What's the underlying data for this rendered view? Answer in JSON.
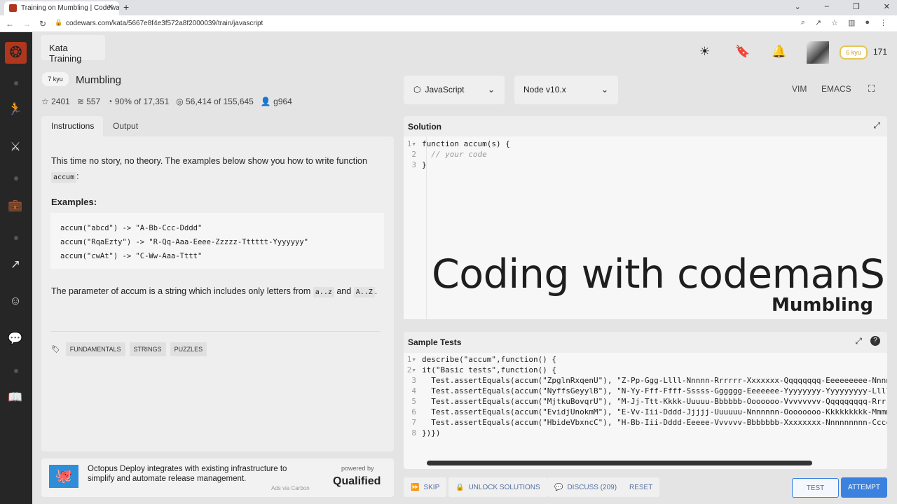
{
  "browser": {
    "tab_title": "Training on Mumbling | Codewars",
    "url": "codewars.com/kata/5667e8f4e3f572a8f2000039/train/javascript"
  },
  "header": {
    "section": "Kata Training",
    "rank": "6 kyu",
    "honor": "171"
  },
  "kata": {
    "rank": "7 kyu",
    "title": "Mumbling",
    "stars": "2401",
    "collections": "557",
    "satisfaction": "90%",
    "satisfaction_of": "of 17,351",
    "completed": "56,414",
    "completed_of": "of 155,645",
    "author": "g964"
  },
  "tabs": {
    "instructions": "Instructions",
    "output": "Output"
  },
  "description": {
    "intro": "This time no story, no theory. The examples below show you how to write function",
    "intro_code": "accum",
    "intro_end": ":",
    "examples_heading": "Examples:",
    "examples": [
      "accum(\"abcd\") -> \"A-Bb-Ccc-Dddd\"",
      "accum(\"RqaEzty\") -> \"R-Qq-Aaa-Eeee-Zzzzz-Tttttt-Yyyyyyy\"",
      "accum(\"cwAt\") -> \"C-Ww-Aaa-Tttt\""
    ],
    "param_text": "The parameter of accum is a string which includes only letters from",
    "range1": "a..z",
    "and": "and",
    "range2": "A..Z",
    "period": "."
  },
  "tags": [
    "FUNDAMENTALS",
    "STRINGS",
    "PUZZLES"
  ],
  "ad": {
    "text": "Octopus Deploy integrates with existing infrastructure to simplify and automate release management.",
    "via": "Ads via Carbon",
    "powered_by": "powered by",
    "brand": "Qualified"
  },
  "editor": {
    "language": "JavaScript",
    "runtime": "Node v10.x",
    "vim": "VIM",
    "emacs": "EMACS",
    "solution_title": "Solution",
    "solution_lines": [
      "function accum(s) {",
      "  // your code",
      "}"
    ],
    "overlay_title": "Coding with codemanS",
    "overlay_sub": "Mumbling",
    "tests_title": "Sample Tests",
    "test_lines": [
      "describe(\"accum\",function() {",
      "it(\"Basic tests\",function() {",
      "  Test.assertEquals(accum(\"ZpglnRxqenU\"), \"Z-Pp-Ggg-Llll-Nnnnn-Rrrrrr-Xxxxxxx-Qqqqqqqq-Eeeeeeeee-Nnnnn",
      "  Test.assertEquals(accum(\"NyffsGeyylB\"), \"N-Yy-Fff-Ffff-Sssss-Gggggg-Eeeeeee-Yyyyyyyy-Yyyyyyyyy-Lllll",
      "  Test.assertEquals(accum(\"MjtkuBovqrU\"), \"M-Jj-Ttt-Kkkk-Uuuuu-Bbbbbb-Ooooooo-Vvvvvvvv-Qqqqqqqqq-Rrrrr",
      "  Test.assertEquals(accum(\"EvidjUnokmM\"), \"E-Vv-Iii-Dddd-Jjjjj-Uuuuuu-Nnnnnnn-Oooooooo-Kkkkkkkkk-Mmmmm",
      "  Test.assertEquals(accum(\"HbideVbxncC\"), \"H-Bb-Iii-Dddd-Eeeee-Vvvvvv-Bbbbbbb-Xxxxxxxx-Nnnnnnnnn-Ccccc",
      "})})"
    ]
  },
  "actions": {
    "skip": "SKIP",
    "unlock": "UNLOCK SOLUTIONS",
    "discuss": "DISCUSS (209)",
    "reset": "RESET",
    "test": "TEST",
    "attempt": "ATTEMPT"
  },
  "colors": {
    "brand": "#b1361e",
    "accent": "#3b82e0",
    "rank_badge": "#e5c558"
  }
}
